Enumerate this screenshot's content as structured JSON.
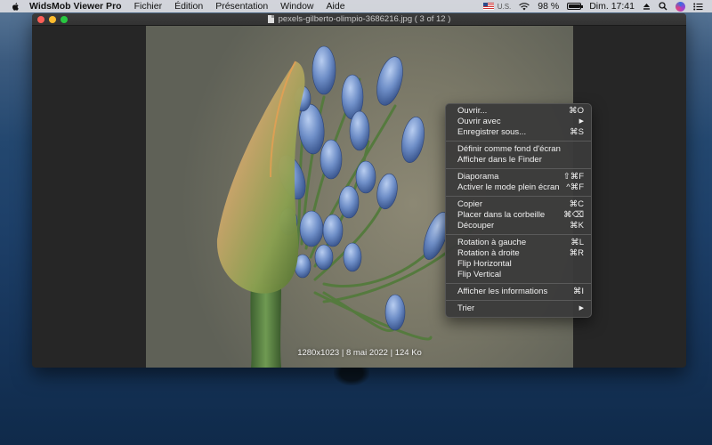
{
  "menubar": {
    "app_name": "WidsMob Viewer Pro",
    "menus": [
      "Fichier",
      "Édition",
      "Présentation",
      "Window",
      "Aide"
    ],
    "status": {
      "input_lang": "U.S.",
      "battery_text": "98 %",
      "battery_level": 0.98,
      "clock": "Dim. 17:41"
    }
  },
  "window": {
    "title": "pexels-gilberto-olimpio-3686216.jpg ( 3 of 12 )"
  },
  "photo": {
    "caption": "1280x1023 | 8 mai 2022 | 124 Ko"
  },
  "context_menu": {
    "groups": [
      [
        {
          "label": "Ouvrir...",
          "shortcut": "⌘O"
        },
        {
          "label": "Ouvrir avec",
          "shortcut": "▶"
        },
        {
          "label": "Enregistrer sous...",
          "shortcut": "⌘S"
        }
      ],
      [
        {
          "label": "Définir comme fond d'écran",
          "shortcut": ""
        },
        {
          "label": "Afficher dans le Finder",
          "shortcut": ""
        }
      ],
      [
        {
          "label": "Diaporama",
          "shortcut": "⇧⌘F"
        },
        {
          "label": "Activer le mode plein écran",
          "shortcut": "^⌘F"
        }
      ],
      [
        {
          "label": "Copier",
          "shortcut": "⌘C"
        },
        {
          "label": "Placer dans la corbeille",
          "shortcut": "⌘⌫"
        },
        {
          "label": "Découper",
          "shortcut": "⌘K"
        }
      ],
      [
        {
          "label": "Rotation à gauche",
          "shortcut": "⌘L"
        },
        {
          "label": "Rotation à droite",
          "shortcut": "⌘R"
        },
        {
          "label": "Flip Horizontal",
          "shortcut": ""
        },
        {
          "label": "Flip Vertical",
          "shortcut": ""
        }
      ],
      [
        {
          "label": "Afficher les informations",
          "shortcut": "⌘I"
        }
      ],
      [
        {
          "label": "Trier",
          "shortcut": "▶"
        }
      ]
    ]
  },
  "colors": {
    "window_bg": "#262626",
    "menu_bg": "#3a3a3a",
    "close": "#fe5f57",
    "minimize": "#febc2e",
    "maximize": "#28c840",
    "bud_blue": "#6f8fc8",
    "stem_green": "#4d7a3a"
  }
}
